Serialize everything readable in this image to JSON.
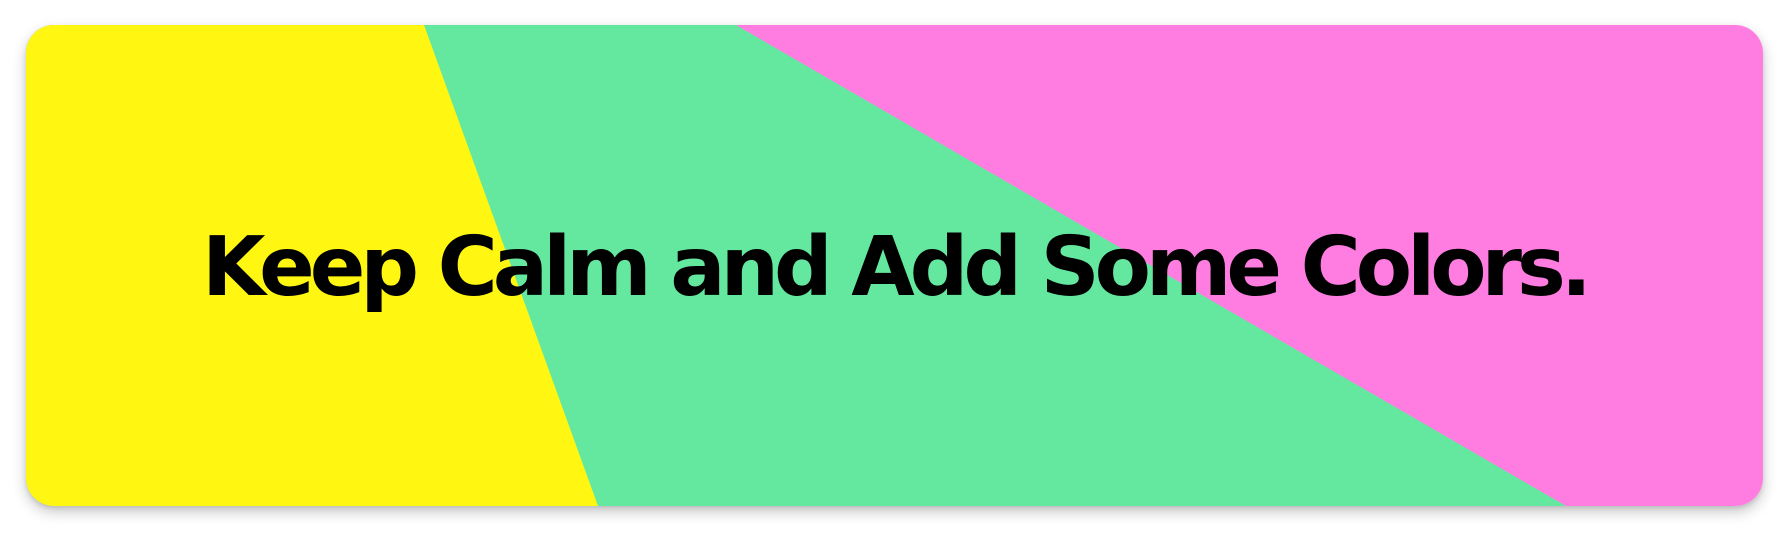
{
  "banner": {
    "headline": "Keep Calm and Add Some Colors.",
    "colors": {
      "yellow": "#FFF712",
      "green": "#64E89F",
      "pink": "#FF7DE1",
      "text": "#000000",
      "page_background": "#FFFFFF"
    }
  }
}
